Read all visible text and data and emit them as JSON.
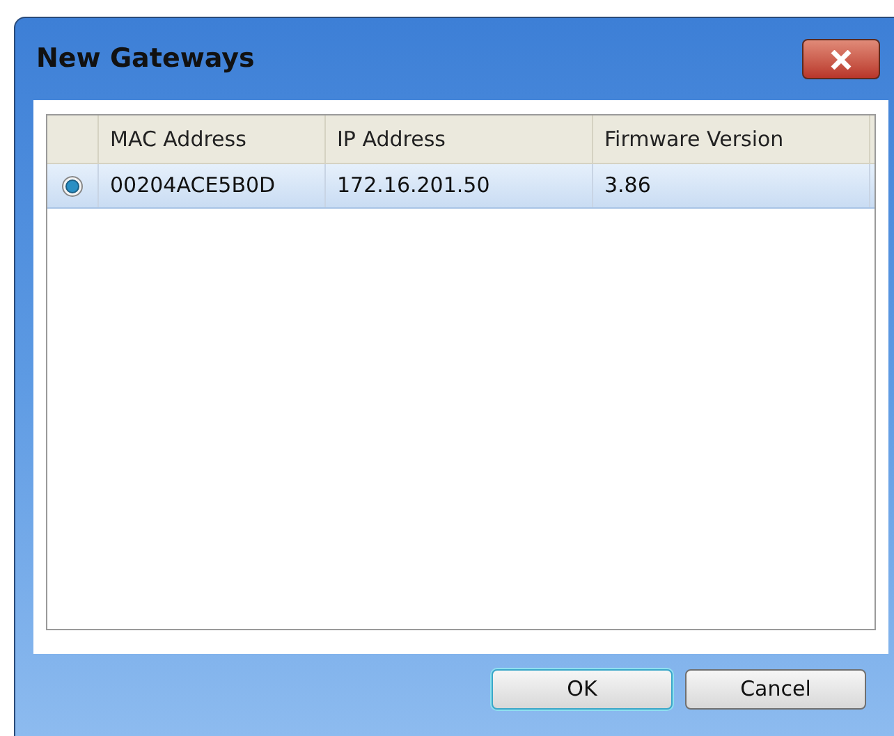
{
  "window": {
    "title": "New Gateways"
  },
  "table": {
    "columns": [
      "MAC Address",
      "IP Address",
      "Firmware Version"
    ],
    "rows": [
      {
        "selected": true,
        "cells": [
          "00204ACE5B0D",
          "172.16.201.50",
          "3.86"
        ]
      }
    ]
  },
  "buttons": [
    {
      "label": "OK",
      "default": true
    },
    {
      "label": "Cancel",
      "default": false
    }
  ]
}
